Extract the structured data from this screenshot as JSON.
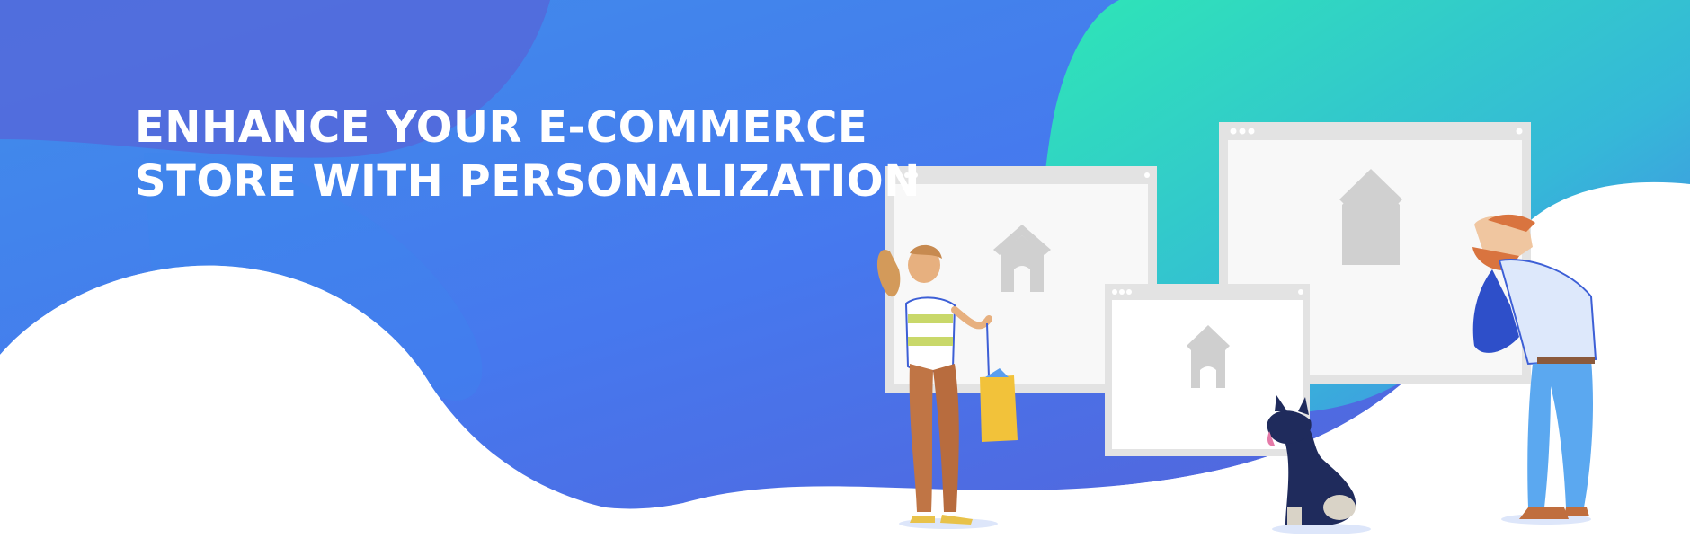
{
  "hero": {
    "headline_line1": "ENHANCE YOUR E-COMMERCE",
    "headline_line2": "STORE WITH PERSONALIZATION"
  },
  "colors": {
    "blue": "#4477EE",
    "blue_dark": "#4A66D8",
    "teal": "#2EE3B8",
    "window_frame": "#E2E2E2",
    "window_body": "#F7F7F7",
    "house_icon": "#CFCFCF",
    "background": "#FFFFFF"
  },
  "illustration": {
    "windows": [
      "browser-window",
      "browser-window",
      "browser-window"
    ],
    "window_icon": "house-icon",
    "characters": [
      "woman-with-handbag",
      "dog",
      "bearded-man"
    ]
  }
}
